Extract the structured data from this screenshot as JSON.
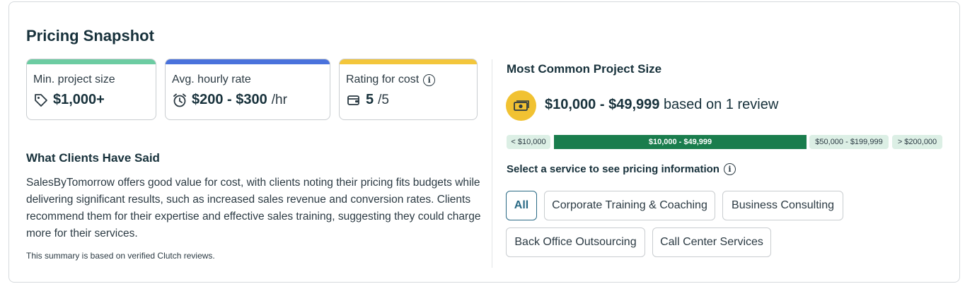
{
  "title": "Pricing Snapshot",
  "stats": [
    {
      "label": "Min. project size",
      "icon": "price-tag-icon",
      "value": "$1,000+",
      "unit": "",
      "color": "#6ccca2"
    },
    {
      "label": "Avg. hourly rate",
      "icon": "alarm-clock-icon",
      "value": "$200 - $300",
      "unit": "/hr",
      "color": "#4a72dc"
    },
    {
      "label": "Rating for cost",
      "icon": "wallet-icon",
      "value": "5",
      "unit": "/5",
      "color": "#f3c63b",
      "info": "i"
    }
  ],
  "clients": {
    "heading": "What Clients Have Said",
    "text": "SalesByTomorrow offers good value for cost, with clients noting their pricing fits budgets while delivering significant results, such as increased sales revenue and conversion rates. Clients recommend them for their expertise and effective sales training, suggesting they could charge more for their services.",
    "note": "This summary is based on verified Clutch reviews."
  },
  "common": {
    "heading": "Most Common Project Size",
    "icon": "money-icon",
    "value": "$10,000 - $49,999",
    "suffix": "based on 1 review"
  },
  "ranges": [
    {
      "label": "< $10,000",
      "active": false
    },
    {
      "label": "$10,000 - $49,999",
      "active": true
    },
    {
      "label": "$50,000 - $199,999",
      "active": false
    },
    {
      "label": "> $200,000",
      "active": false
    }
  ],
  "service_select": {
    "heading": "Select a service to see pricing information",
    "info": "i",
    "options": [
      "All",
      "Corporate Training & Coaching",
      "Business Consulting",
      "Back Office Outsourcing",
      "Call Center Services"
    ],
    "selected": "All"
  },
  "colors": {
    "accent_green": "#1a7d4d",
    "range_bg": "#dcefe5",
    "badge_yellow": "#f1c232",
    "selected_chip": "#2a6a85"
  }
}
